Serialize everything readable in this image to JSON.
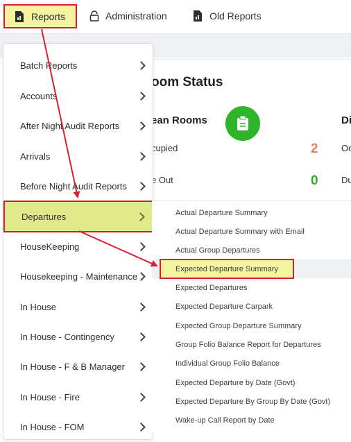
{
  "topnav": {
    "reports": "Reports",
    "administration": "Administration",
    "old_reports": "Old Reports"
  },
  "card": {
    "title": "oom Status",
    "clean_rooms": "ean Rooms",
    "dirty_prefix": "Di",
    "occupied_label": "cupied",
    "occupied_value": "2",
    "occupied_right": "Oc",
    "due_out_label": "e Out",
    "due_out_value": "0",
    "due_out_right": "Du"
  },
  "menu": {
    "items": [
      {
        "label": "Batch Reports"
      },
      {
        "label": "Accounts"
      },
      {
        "label": "After Night Audit Reports"
      },
      {
        "label": "Arrivals"
      },
      {
        "label": "Before Night Audit Reports"
      },
      {
        "label": "Departures"
      },
      {
        "label": "HouseKeeping"
      },
      {
        "label": "Housekeeping - Maintenance"
      },
      {
        "label": "In House"
      },
      {
        "label": "In House - Contingency"
      },
      {
        "label": "In House - F & B Manager"
      },
      {
        "label": "In House - Fire"
      },
      {
        "label": "In House - FOM"
      }
    ]
  },
  "submenu": {
    "items": [
      {
        "label": "Actual Departure Summary"
      },
      {
        "label": "Actual Departure Summary with Email"
      },
      {
        "label": "Actual Group Departures"
      },
      {
        "label": "Expected Departure Summary"
      },
      {
        "label": "Expected Departures"
      },
      {
        "label": "Expected Departure Carpark"
      },
      {
        "label": "Expected Group Departure Summary"
      },
      {
        "label": "Group Folio Balance Report for Departures"
      },
      {
        "label": "Individual Group Folio Balance"
      },
      {
        "label": "Expected Departure by Date (Govt)"
      },
      {
        "label": "Expected Departure By Group By Date (Govt)"
      },
      {
        "label": "Wake-up Call Report by Date"
      }
    ]
  },
  "colors": {
    "highlight_yellow": "#f3f3a0",
    "active_green": "#dfe98a",
    "annotation_red": "#d8202c",
    "status_green": "#2eb52a"
  }
}
